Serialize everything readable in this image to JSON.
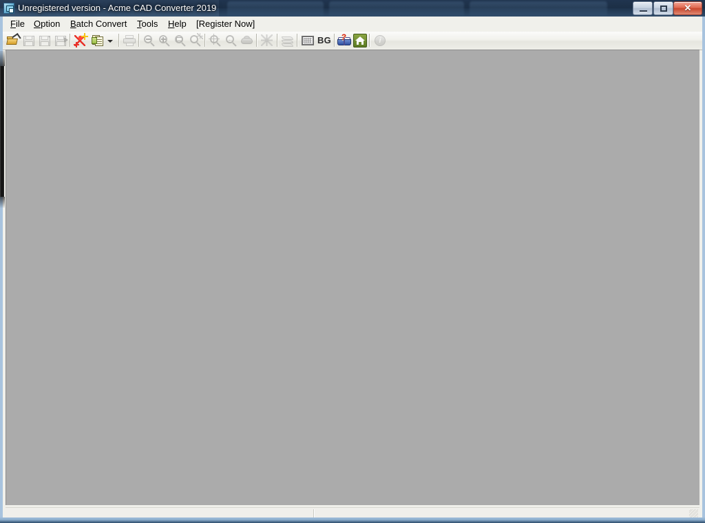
{
  "window": {
    "title": "Unregistered version - Acme CAD Converter 2019",
    "icon": "app-icon",
    "buttons": {
      "minimize": "–",
      "maximize": "□",
      "close": "✕"
    }
  },
  "backdrop": {
    "tabs": [
      {
        "title": "",
        "active": false
      },
      {
        "title": "",
        "active": true
      }
    ]
  },
  "menubar": {
    "items": [
      {
        "name": "file",
        "accel": "F",
        "rest": "ile"
      },
      {
        "name": "option",
        "accel": "O",
        "rest": "ption"
      },
      {
        "name": "batch-convert",
        "accel": "B",
        "rest": "atch Convert"
      },
      {
        "name": "tools",
        "accel": "T",
        "rest": "ools"
      },
      {
        "name": "help",
        "accel": "H",
        "rest": "elp"
      },
      {
        "name": "register-now",
        "accel": "",
        "rest": "[Register Now]"
      }
    ]
  },
  "toolbar": {
    "buttons": [
      {
        "name": "open-file",
        "icon": "open-folder-icon",
        "enabled": true
      },
      {
        "name": "save-file",
        "icon": "save-floppy-icon",
        "enabled": false
      },
      {
        "name": "save-as",
        "icon": "save-as-icon",
        "enabled": false
      },
      {
        "name": "save-selected",
        "icon": "save-export-icon",
        "enabled": false
      },
      {
        "name": "batch-convert",
        "icon": "batch-convert-icon",
        "enabled": true
      },
      {
        "name": "multi-page",
        "icon": "pages-icon",
        "enabled": true
      },
      {
        "name": "print",
        "icon": "printer-icon",
        "enabled": false
      },
      {
        "name": "zoom-out",
        "icon": "zoom-out-icon",
        "enabled": false
      },
      {
        "name": "zoom-in",
        "icon": "zoom-in-icon",
        "enabled": false
      },
      {
        "name": "zoom-window",
        "icon": "zoom-window-icon",
        "enabled": false
      },
      {
        "name": "zoom-dynamic",
        "icon": "zoom-dynamic-icon",
        "enabled": false
      },
      {
        "name": "zoom-all",
        "icon": "zoom-all-icon",
        "enabled": false
      },
      {
        "name": "zoom-previous",
        "icon": "zoom-previous-icon",
        "enabled": false
      },
      {
        "name": "pan",
        "icon": "pan-hand-icon",
        "enabled": false
      },
      {
        "name": "measure",
        "icon": "measure-icon",
        "enabled": false
      },
      {
        "name": "layers",
        "icon": "layers-icon",
        "enabled": false
      },
      {
        "name": "image-grid",
        "icon": "image-grid-icon",
        "enabled": true
      },
      {
        "name": "background-color",
        "icon": "bg-text-icon",
        "enabled": true,
        "label": "BG"
      },
      {
        "name": "help-topics",
        "icon": "help-book-icon",
        "enabled": true
      },
      {
        "name": "home-page",
        "icon": "home-icon",
        "enabled": true
      },
      {
        "name": "about-info",
        "icon": "info-icon",
        "enabled": false
      }
    ],
    "bg_label": "BG",
    "info_glyph": "i",
    "help_glyph": "?"
  },
  "canvas": {
    "background_color": "#ababab",
    "content": ""
  },
  "statusbar": {
    "panes": [
      {
        "name": "status-message",
        "text": ""
      },
      {
        "name": "status-secondary",
        "text": ""
      }
    ],
    "grip": "resize-grip"
  },
  "colors": {
    "canvas": "#ababab",
    "frame": "#a8c3de",
    "toolbar": "#f1f1ec",
    "menubar": "#f0f0eb",
    "titlebar": "#1c324e",
    "close_button": "#c9462d",
    "statusbar": "#f0efeb"
  }
}
